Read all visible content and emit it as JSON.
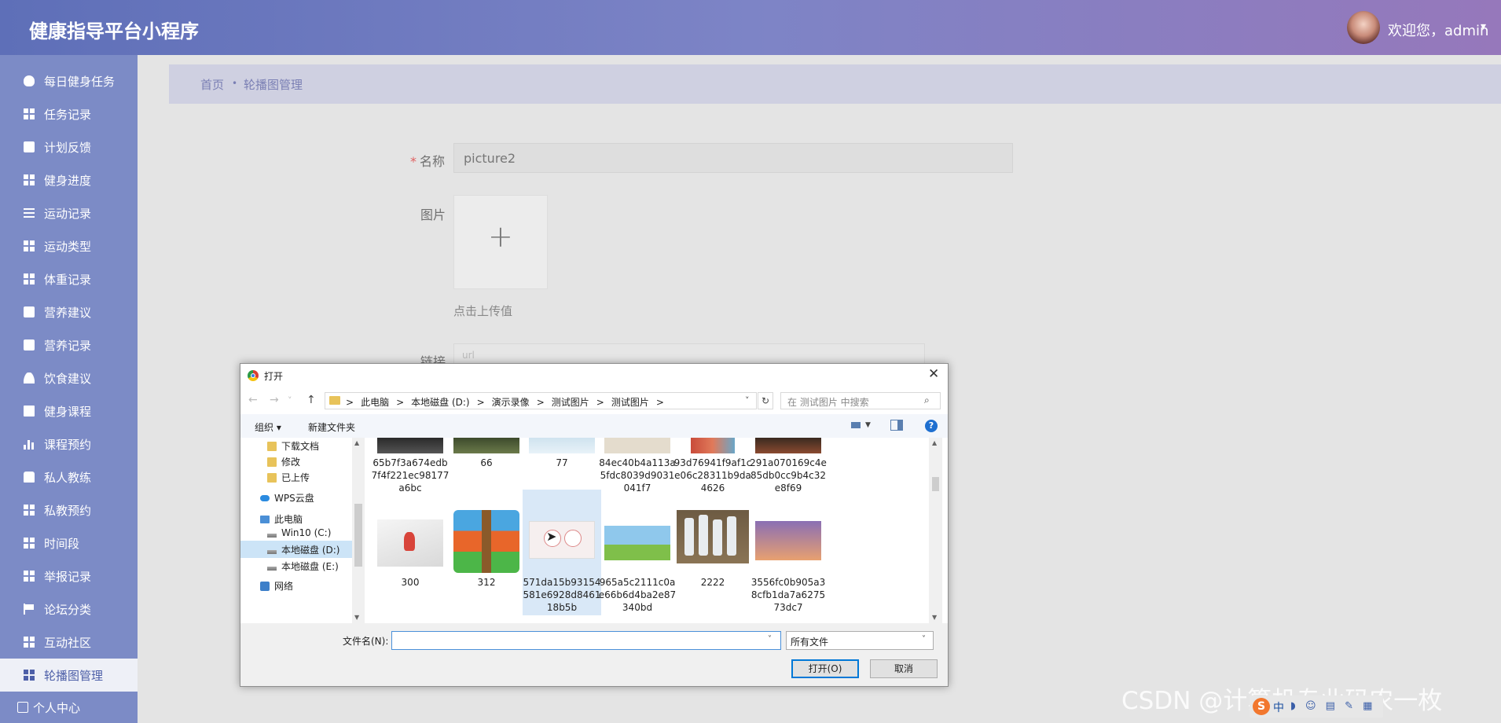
{
  "header": {
    "title": "健康指导平台小程序",
    "welcome": "欢迎您，admin",
    "caret": "▾"
  },
  "sidebar": {
    "items": [
      {
        "label": "每日健身任务",
        "icon": "bulb-icon"
      },
      {
        "label": "任务记录",
        "icon": "grid-icon"
      },
      {
        "label": "计划反馈",
        "icon": "pin-icon"
      },
      {
        "label": "健身进度",
        "icon": "grid-icon"
      },
      {
        "label": "运动记录",
        "icon": "list-icon"
      },
      {
        "label": "运动类型",
        "icon": "grid-icon"
      },
      {
        "label": "体重记录",
        "icon": "grid-icon"
      },
      {
        "label": "营养建议",
        "icon": "message-icon"
      },
      {
        "label": "营养记录",
        "icon": "message-icon"
      },
      {
        "label": "饮食建议",
        "icon": "user-icon"
      },
      {
        "label": "健身课程",
        "icon": "clipboard-icon"
      },
      {
        "label": "课程预约",
        "icon": "bar-chart-icon"
      },
      {
        "label": "私人教练",
        "icon": "thumb-icon"
      },
      {
        "label": "私教预约",
        "icon": "grid-icon"
      },
      {
        "label": "时间段",
        "icon": "grid-icon"
      },
      {
        "label": "举报记录",
        "icon": "grid-icon"
      },
      {
        "label": "论坛分类",
        "icon": "flag-icon"
      },
      {
        "label": "互动社区",
        "icon": "grid-icon"
      },
      {
        "label": "轮播图管理",
        "icon": "grid-icon",
        "active": true
      },
      {
        "label": "个人中心",
        "icon": "card-icon"
      }
    ]
  },
  "breadcrumb": {
    "home": "首页",
    "sep": "•",
    "current": "轮播图管理"
  },
  "form": {
    "required_mark": "*",
    "name_label": "名称",
    "name_value": "picture2",
    "image_label": "图片",
    "upload_plus": "+",
    "upload_hint": "点击上传值",
    "link_label": "链接",
    "link_placeholder": "url"
  },
  "dialog": {
    "title": "打开",
    "close": "✕",
    "nav": {
      "back": "←",
      "forward": "→",
      "down": "˅",
      "up": "↑"
    },
    "path": [
      "此电脑",
      "本地磁盘 (D:)",
      "演示录像",
      "测试图片",
      "测试图片"
    ],
    "path_sep": ">",
    "refresh": "↻",
    "search_placeholder": "在 测试图片 中搜索",
    "toolbar": {
      "organize": "组织 ▾",
      "new_folder": "新建文件夹"
    },
    "help": "?",
    "tree": [
      {
        "label": "下载文档",
        "type": "folder"
      },
      {
        "label": "修改",
        "type": "folder"
      },
      {
        "label": "已上传",
        "type": "folder"
      },
      {
        "label": "WPS云盘",
        "type": "cloud"
      },
      {
        "label": "此电脑",
        "type": "pc"
      },
      {
        "label": "Win10 (C:)",
        "type": "drive"
      },
      {
        "label": "本地磁盘 (D:)",
        "type": "drive",
        "selected": true
      },
      {
        "label": "本地磁盘 (E:)",
        "type": "drive"
      },
      {
        "label": "网络",
        "type": "network"
      }
    ],
    "files_row1": [
      {
        "name": "65b7f3a674edb7f4f221ec98177a6bc"
      },
      {
        "name": "66"
      },
      {
        "name": "77"
      },
      {
        "name": "84ec40b4a113a5fdc8039d9031041f7"
      },
      {
        "name": "93d76941f9af1ce06c28311b9da4626"
      },
      {
        "name": "291a070169c4e85db0cc9b4c32e8f69"
      }
    ],
    "files_row2": [
      {
        "name": "300"
      },
      {
        "name": "312"
      },
      {
        "name": "571da15b93154581e6928d846118b5b",
        "selected": true
      },
      {
        "name": "965a5c2111c0ae66b6d4ba2e87340bd"
      },
      {
        "name": "2222"
      },
      {
        "name": "3556fc0b905a38cfb1da7a627573dc7"
      }
    ],
    "filename_label": "文件名(N):",
    "filename_value": "",
    "filetype": "所有文件",
    "open_button": "打开(O)",
    "cancel_button": "取消"
  },
  "watermark": "CSDN @计算机专业码农一枚",
  "tray": {
    "sogou": "S",
    "lang": "中"
  },
  "colors": {
    "sidebar": "#7c8bc6",
    "header_start": "#5e6fb8",
    "header_end": "#9678bb",
    "accent": "#4d5fa8"
  }
}
